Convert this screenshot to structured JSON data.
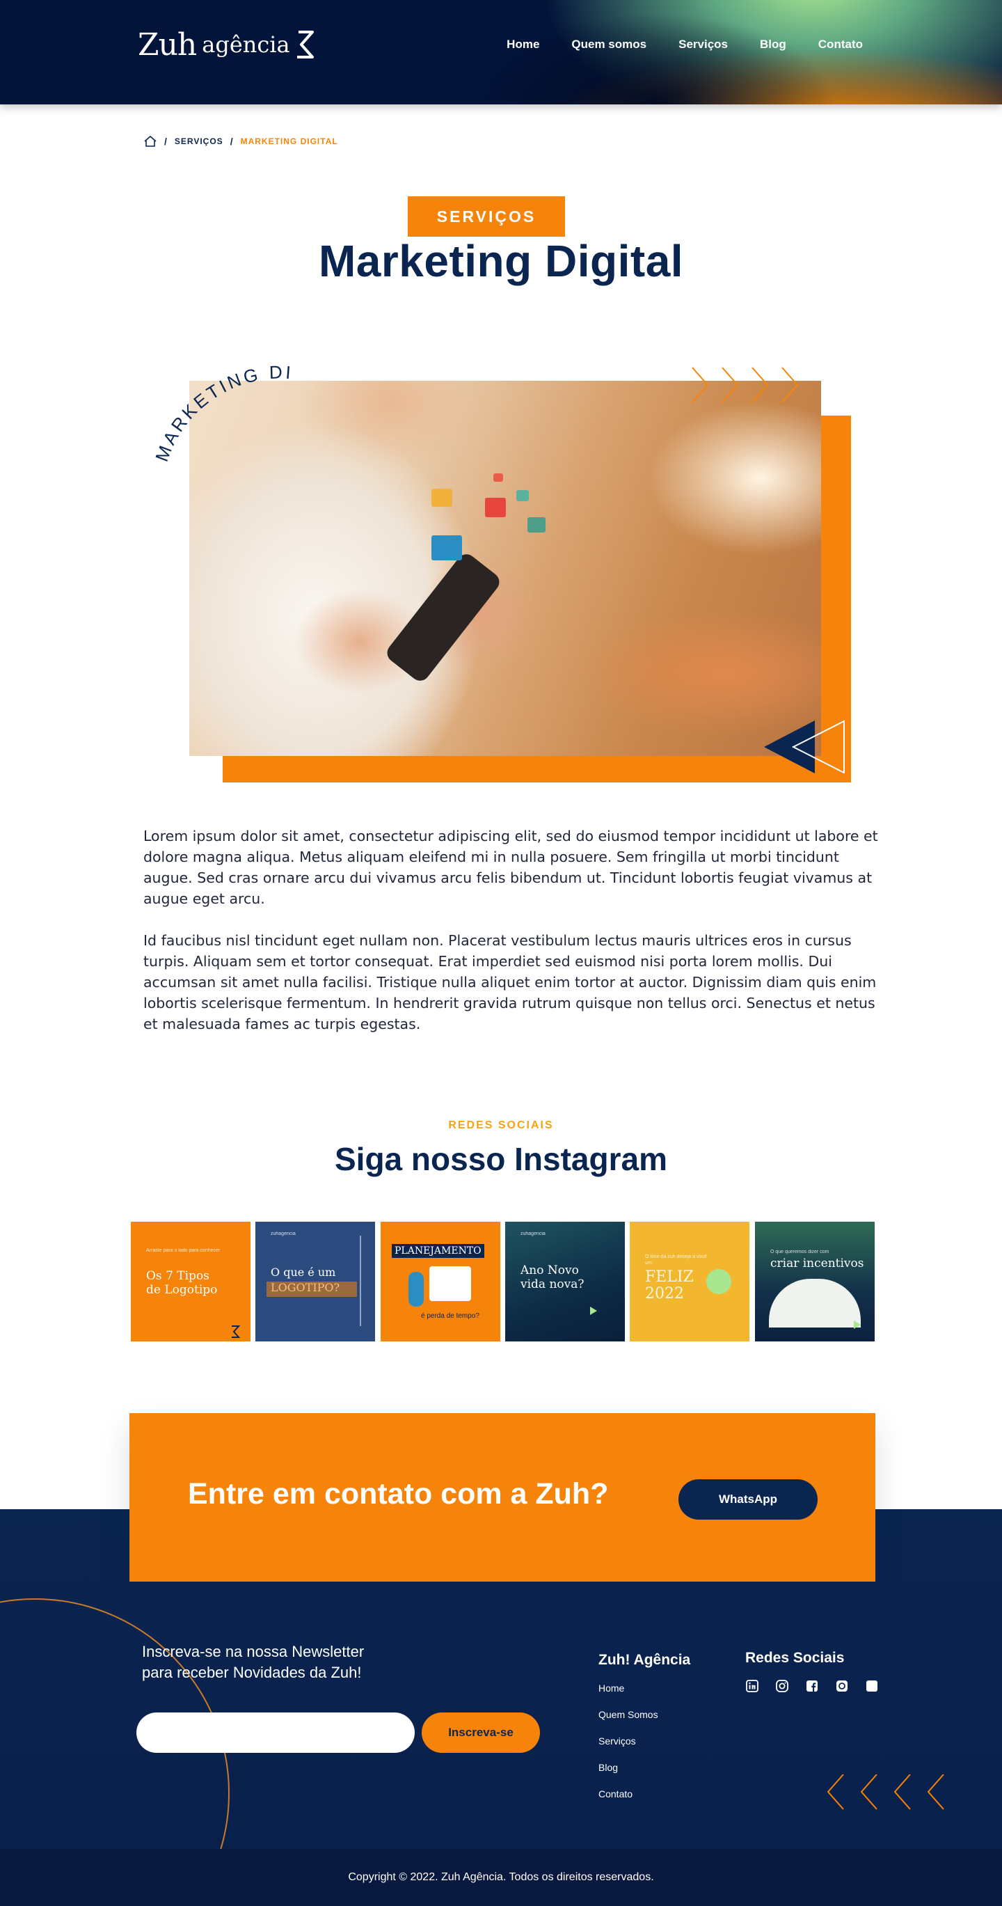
{
  "brand": {
    "name_part1": "Zuh",
    "name_part2": "agência",
    "accent": "#f7840a",
    "navy": "#0b2551"
  },
  "nav": {
    "items": [
      "Home",
      "Quem somos",
      "Serviços",
      "Blog",
      "Contato"
    ]
  },
  "breadcrumb": {
    "home_icon": "home-icon",
    "level1": "SERVIÇOS",
    "level2": "MARKETING DIGITAL",
    "separator": "/"
  },
  "hero": {
    "pill": "SERVIÇOS",
    "title": "Marketing Digital",
    "curved_label": "MARKETING DIGITAL"
  },
  "body": {
    "paragraphs": [
      "Lorem ipsum dolor sit amet, consectetur adipiscing elit, sed do eiusmod tempor incididunt ut labore et dolore magna aliqua. Metus aliquam eleifend mi in nulla posuere. Sem fringilla ut morbi tincidunt augue. Sed cras ornare arcu dui vivamus arcu felis bibendum ut. Tincidunt lobortis feugiat vivamus at augue eget arcu.",
      "Id faucibus nisl tincidunt eget nullam non. Placerat vestibulum lectus mauris ultrices eros in cursus turpis. Aliquam sem et tortor consequat. Erat imperdiet sed euismod nisi porta lorem mollis. Dui accumsan sit amet nulla facilisi. Tristique nulla aliquet enim tortor at auctor. Dignissim diam quis enim lobortis scelerisque fermentum. In hendrerit gravida rutrum quisque non tellus orci. Senectus et netus et malesuada fames ac turpis egestas."
    ]
  },
  "instagram": {
    "kicker": "REDES SOCIAIS",
    "title": "Siga nosso Instagram",
    "posts": [
      {
        "text": "Os 7 Tipos de Logotipo",
        "small": "Arraste para o lado para conhecer",
        "bg": "#f7840a"
      },
      {
        "text": "O que é um LOGOTIPO?",
        "small": "zuhagencia",
        "bg": "#2b4b7e"
      },
      {
        "text": "PLANEJAMENTO",
        "small": "é perda de tempo?",
        "bg": "#f7840a"
      },
      {
        "text": "Ano Novo vida nova?",
        "small": "zuhagencia",
        "bg": "#123a55"
      },
      {
        "text": "FELIZ 2022",
        "small": "O time da zuh deseja a você um",
        "bg": "#f2b72f"
      },
      {
        "text": "criar incentivos",
        "small": "O que queremos dizer com",
        "bg": "#1d4a4f"
      }
    ]
  },
  "cta": {
    "title": "Entre em contato com a Zuh?",
    "button": "WhatsApp"
  },
  "footer": {
    "newsletter_line1": "Inscreva-se na nossa Newsletter",
    "newsletter_line2": "para receber Novidades da Zuh!",
    "newsletter_placeholder": "",
    "newsletter_button": "Inscreva-se",
    "col1_title": "Zuh! Agência",
    "col1_links": [
      "Home",
      "Quem Somos",
      "Serviços",
      "Blog",
      "Contato"
    ],
    "col2_title": "Redes Sociais",
    "social_icons": [
      "linkedin-icon",
      "instagram-icon",
      "facebook-icon",
      "pinterest-icon",
      "behance-icon"
    ],
    "copyright": "Copyright © 2022. Zuh Agência. Todos os direitos reservados."
  }
}
